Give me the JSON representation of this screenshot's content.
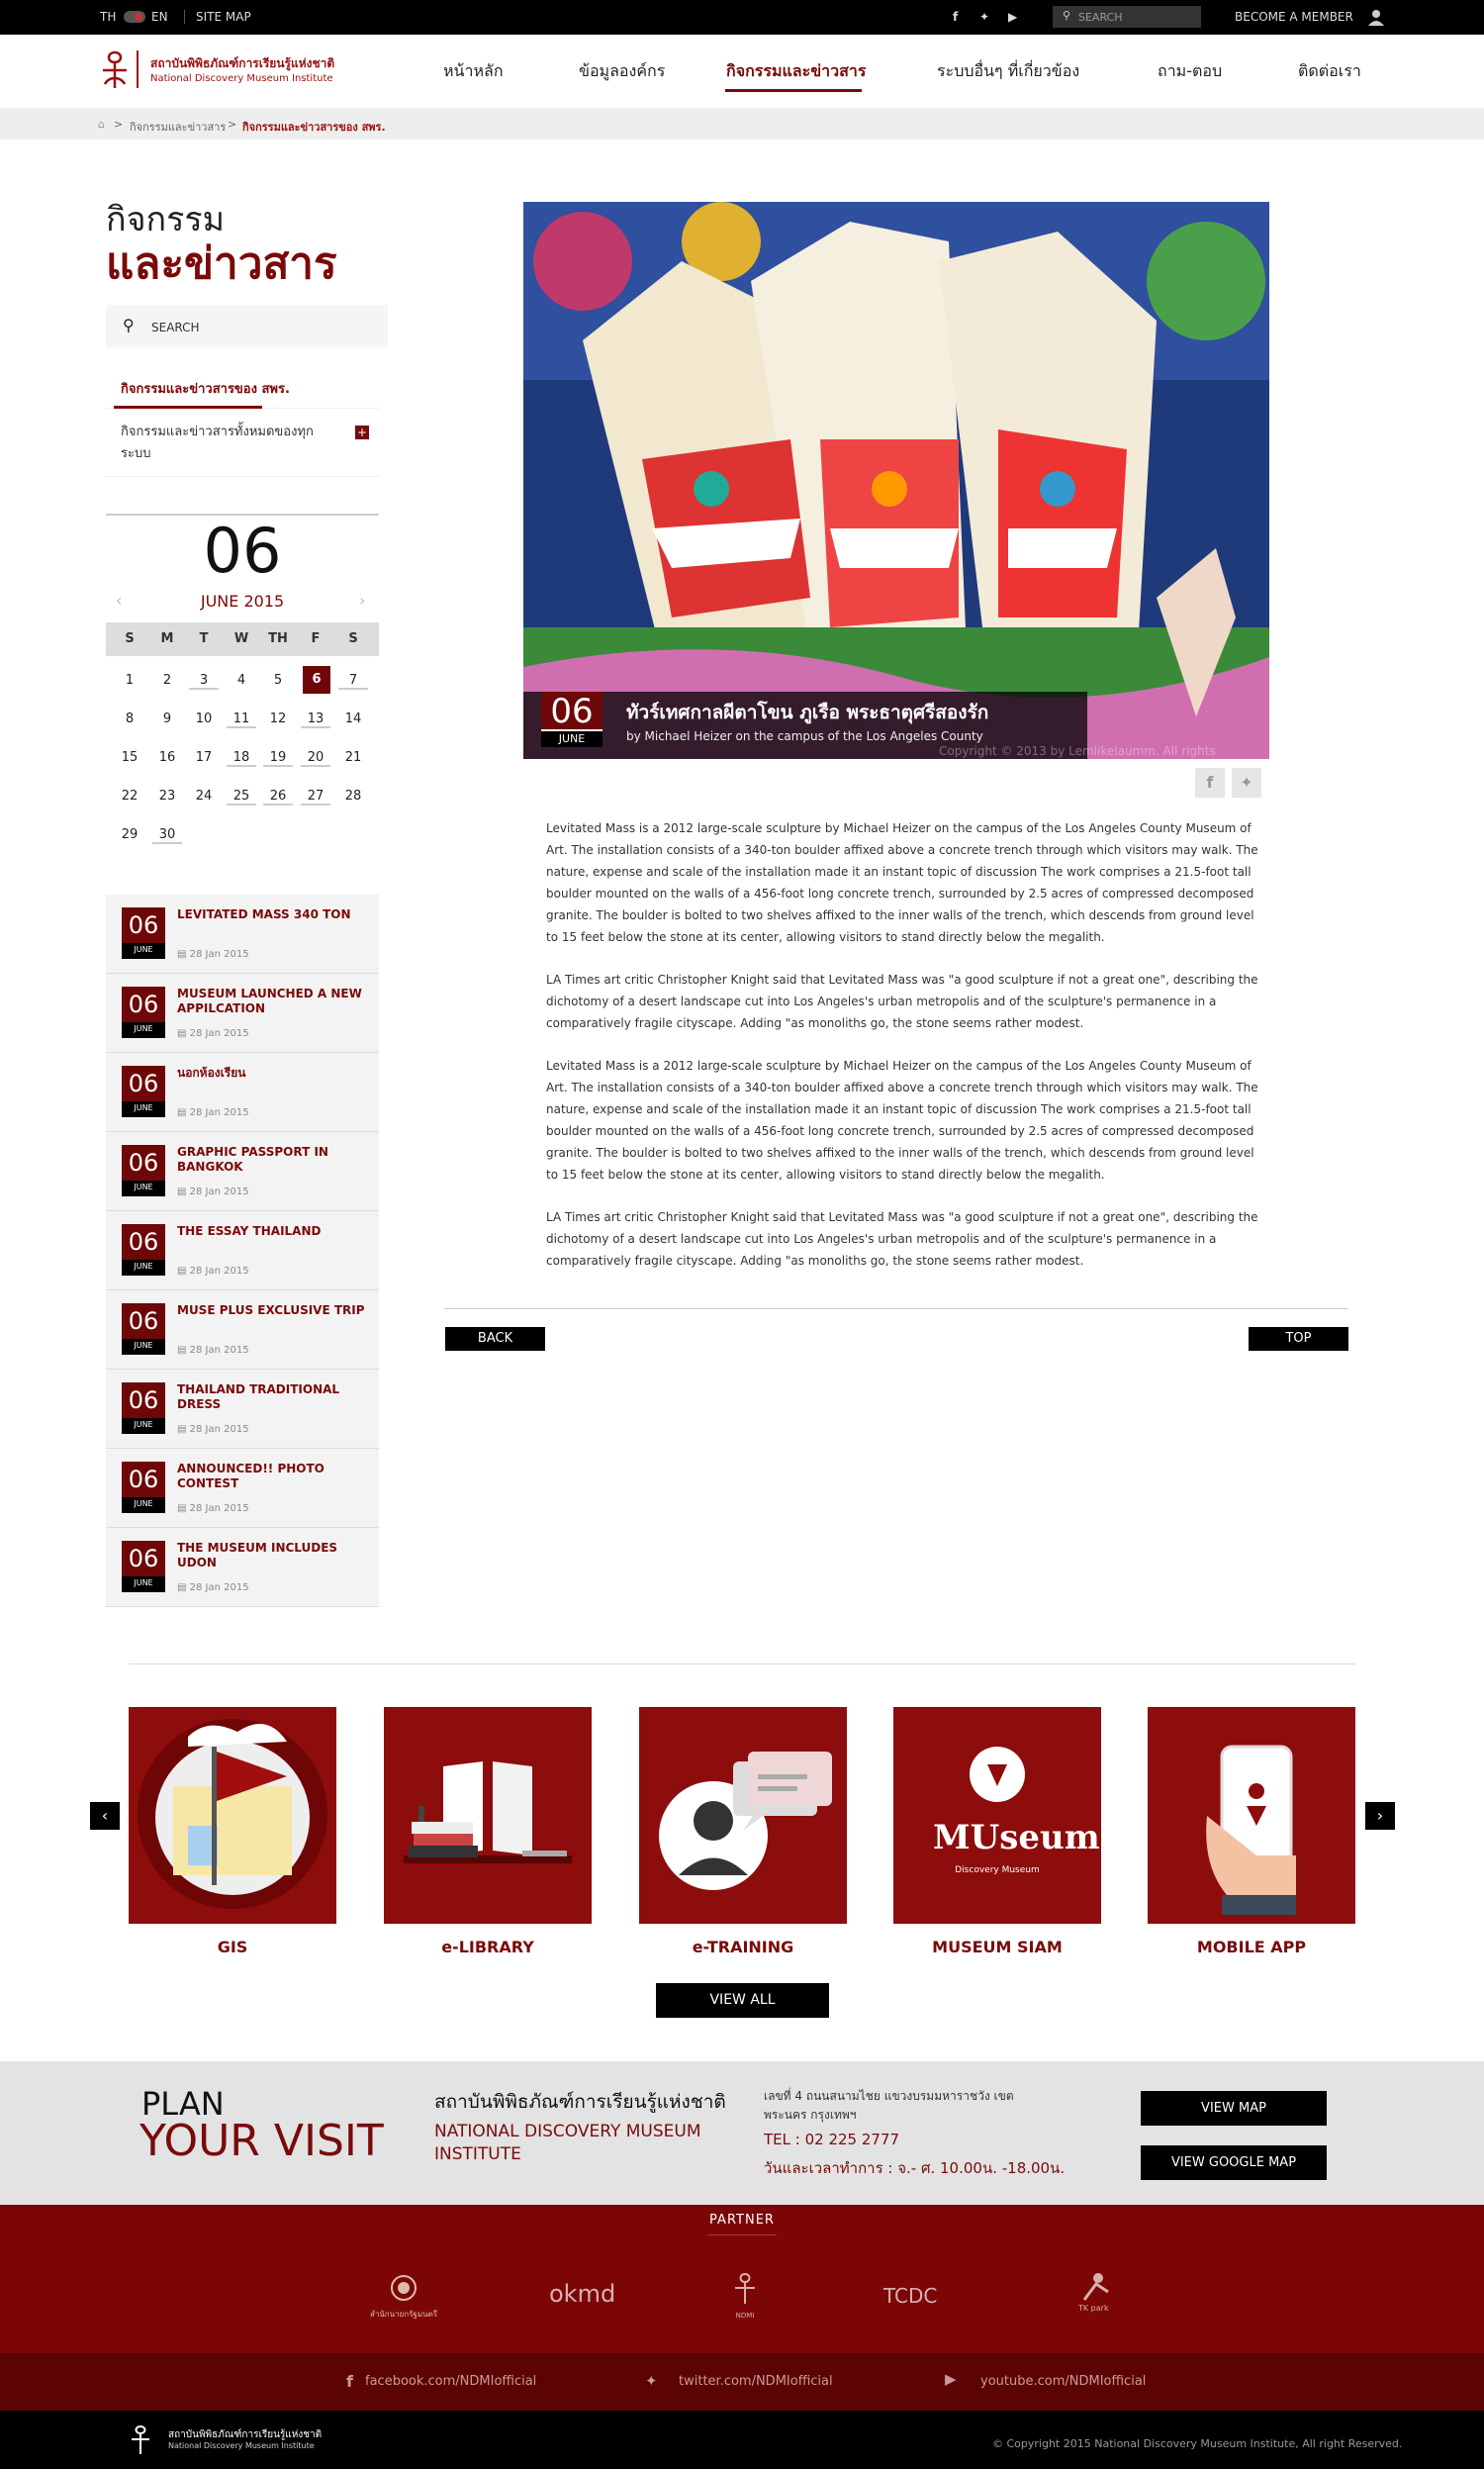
{
  "topbar": {
    "lang_th": "TH",
    "lang_en": "EN",
    "sitemap": "SITE MAP",
    "search_placeholder": "SEARCH",
    "member": "BECOME A MEMBER"
  },
  "header": {
    "logo_th": "สถาบันพิพิธภัณฑ์การเรียนรู้แห่งชาติ",
    "logo_en": "National Discovery Museum Institute",
    "nav": [
      "หน้าหลัก",
      "ข้อมูลองค์กร",
      "กิจกรรมและข่าวสาร",
      "ระบบอื่นๆ ที่เกี่ยวข้อง",
      "ถาม-ตอบ",
      "ติดต่อเรา"
    ]
  },
  "breadcrumb": {
    "level1": "กิจกรรมและข่าวสาร",
    "level2": "กิจกรรมและข่าวสารของ สพร."
  },
  "sidebar": {
    "title1": "กิจกรรม",
    "title2": "และข่าวสาร",
    "search": "SEARCH",
    "menu_active": "กิจกรรมและข่าวสารของ สพร.",
    "menu_other": "กิจกรรมและข่าวสารทั้งหมดของทุกระบบ",
    "calendar": {
      "day": "06",
      "month": "JUNE 2015",
      "weekdays": [
        "S",
        "M",
        "T",
        "W",
        "TH",
        "F",
        "S"
      ],
      "weeks": [
        [
          "",
          "1",
          "2",
          "3",
          "4",
          "5",
          "6",
          "7"
        ],
        [
          "8",
          "9",
          "10",
          "11",
          "12",
          "13",
          "14"
        ],
        [
          "15",
          "16",
          "17",
          "18",
          "19",
          "20",
          "21"
        ],
        [
          "22",
          "23",
          "24",
          "25",
          "26",
          "27",
          "28"
        ],
        [
          "29",
          "30"
        ]
      ]
    },
    "news": [
      {
        "day": "06",
        "month": "JUNE",
        "title": "LEVITATED MASS 340 TON",
        "date": "28 Jan 2015"
      },
      {
        "day": "06",
        "month": "JUNE",
        "title": "MUSEUM LAUNCHED A NEW APPILCATION",
        "date": "28 Jan 2015"
      },
      {
        "day": "06",
        "month": "JUNE",
        "title": "นอกห้องเรียน",
        "date": "28 Jan 2015"
      },
      {
        "day": "06",
        "month": "JUNE",
        "title": "GRAPHIC PASSPORT IN BANGKOK",
        "date": "28 Jan 2015"
      },
      {
        "day": "06",
        "month": "JUNE",
        "title": "THE ESSAY THAILAND",
        "date": "28 Jan 2015"
      },
      {
        "day": "06",
        "month": "JUNE",
        "title": "MUSE PLUS EXCLUSIVE TRIP",
        "date": "28 Jan 2015"
      },
      {
        "day": "06",
        "month": "JUNE",
        "title": "THAILAND TRADITIONAL DRESS",
        "date": "28 Jan 2015"
      },
      {
        "day": "06",
        "month": "JUNE",
        "title": "ANNOUNCED!! PHOTO CONTEST",
        "date": "28 Jan 2015"
      },
      {
        "day": "06",
        "month": "JUNE",
        "title": "THE MUSEUM INCLUDES UDON",
        "date": "28 Jan 2015"
      }
    ]
  },
  "article": {
    "day": "06",
    "month": "JUNE",
    "title": "ทัวร์เทศกาลผีตาโขน ภูเรือ พระธาตุศรีสองรัก",
    "byline": "by Michael Heizer on the campus of the Los Angeles County",
    "copyright": "Copyright © 2013 by Lemlikelaumm. All rights",
    "para1": "Levitated Mass is a 2012 large-scale sculpture by Michael Heizer on the campus of the Los Angeles County Museum of Art. The installation consists of a 340-ton boulder affixed above a concrete trench through which visitors may walk. The nature, expense and scale of the installation made it an instant topic of discussion The work comprises a 21.5-foot tall boulder mounted on the walls of a 456-foot long concrete trench, surrounded by 2.5 acres of compressed decomposed granite. The boulder is bolted to two shelves affixed to the inner walls of the trench, which descends from ground level to 15 feet below the stone at its center, allowing visitors to stand directly below the megalith.",
    "para2": "LA Times art critic Christopher Knight said that Levitated Mass was \"a good sculpture if not a great one\", describing the dichotomy of a desert landscape cut into Los Angeles's urban metropolis and of the sculpture's permanence in a comparatively fragile cityscape. Adding \"as monoliths go, the stone seems rather modest.",
    "para3": "Levitated Mass is a 2012 large-scale sculpture by Michael Heizer on the campus of the Los Angeles County Museum of Art. The installation consists of a 340-ton boulder affixed above a concrete trench through which visitors may walk. The nature, expense and scale of the installation made it an instant topic of discussion The work comprises a 21.5-foot tall boulder mounted on the walls of a 456-foot long concrete trench, surrounded by 2.5 acres of compressed decomposed granite. The boulder is bolted to two shelves affixed to the inner walls of the trench, which descends from ground level to 15 feet below the stone at its center, allowing visitors to stand directly below the megalith.",
    "para4": "LA Times art critic Christopher Knight said that Levitated Mass was \"a good sculpture if not a great one\", describing the dichotomy of a desert landscape cut into Los Angeles's urban metropolis and of the sculpture's permanence in a comparatively fragile cityscape. Adding \"as monoliths go, the stone seems rather modest.",
    "back": "BACK",
    "top": "TOP"
  },
  "services": {
    "items": [
      "GIS",
      "e-LIBRARY",
      "e-TRAINING",
      "MUSEUM SIAM",
      "MOBILE APP"
    ],
    "view_all": "VIEW ALL",
    "museum_logo": "MUseum Siam",
    "museum_sub": "Discovery Museum"
  },
  "plan": {
    "line1": "PLAN",
    "line2": "YOUR VISIT",
    "org_th": "สถาบันพิพิธภัณฑ์การเรียนรู้แห่งชาติ",
    "org_en": "NATIONAL DISCOVERY MUSEUM INSTITUTE",
    "address": "เลขที่ 4 ถนนสนามไชย แขวงบรมมหาราชวัง เขตพระนคร กรุงเทพฯ",
    "tel": "TEL : 02 225 2777",
    "hours": "วันและเวลาทำการ : จ.- ศ. 10.00น. -18.00น.",
    "view_map": "VIEW MAP",
    "view_google_map": "VIEW GOOGLE MAP"
  },
  "partner": {
    "title": "PARTNER",
    "logos": [
      "สำนักนายกรัฐมนตรี",
      "okmd",
      "NDMI",
      "TCDC",
      "TK park"
    ]
  },
  "social": {
    "facebook": "facebook.com/NDMIofficial",
    "twitter": "twitter.com/NDMIofficial",
    "youtube": "youtube.com/NDMIofficial"
  },
  "footer": {
    "logo_th": "สถาบันพิพิธภัณฑ์การเรียนรู้แห่งชาติ",
    "logo_en": "National Discovery Museum Institute",
    "copyright": "© Copyright 2015 National Discovery Museum Institute, All right Reserved."
  },
  "colors": {
    "brand": "#7a0a0a",
    "dark": "#000000",
    "partner_bg": "#7c0606"
  }
}
